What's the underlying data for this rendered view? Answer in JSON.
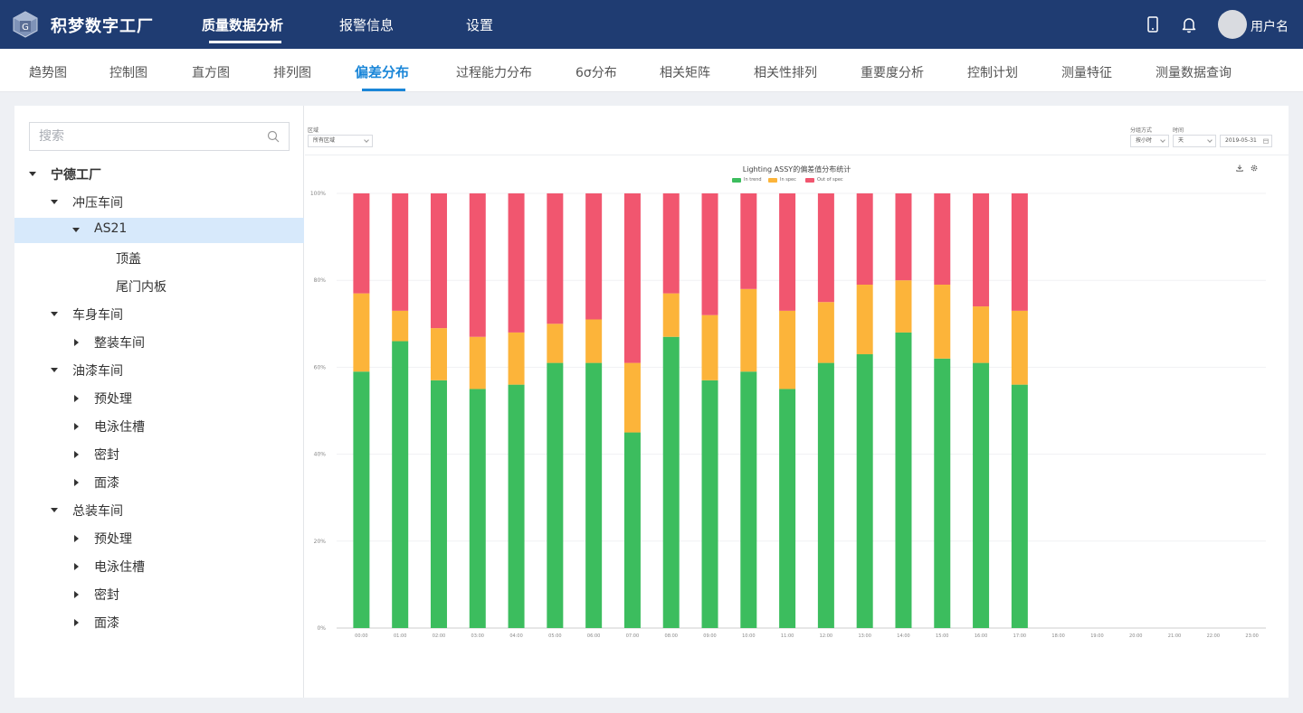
{
  "header": {
    "app_title": "积梦数字工厂",
    "nav": [
      "质量数据分析",
      "报警信息",
      "设置"
    ],
    "active_nav": "质量数据分析",
    "username": "用户名",
    "colors": {
      "background": "#1f3c72",
      "text": "#ffffff"
    },
    "icons": [
      "phone-icon",
      "bell-icon",
      "avatar"
    ]
  },
  "subnav": {
    "tabs": [
      "趋势图",
      "控制图",
      "直方图",
      "排列图",
      "偏差分布",
      "过程能力分布",
      "6σ分布",
      "相关矩阵",
      "相关性排列",
      "重要度分析",
      "控制计划",
      "测量特征",
      "测量数据查询"
    ],
    "active": "偏差分布",
    "accent_color": "#1a86d8"
  },
  "sidebar": {
    "search_placeholder": "搜索",
    "tree": [
      {
        "label": "宁德工厂",
        "level": 0,
        "state": "expanded",
        "bold": true
      },
      {
        "label": "冲压车间",
        "level": 1,
        "state": "expanded"
      },
      {
        "label": "AS21",
        "level": 2,
        "state": "expanded",
        "selected": true
      },
      {
        "label": "顶盖",
        "level": 3,
        "state": "leaf"
      },
      {
        "label": "尾门内板",
        "level": 3,
        "state": "leaf"
      },
      {
        "label": "车身车间",
        "level": 1,
        "state": "expanded"
      },
      {
        "label": "整装车间",
        "level": 2,
        "state": "collapsed"
      },
      {
        "label": "油漆车间",
        "level": 1,
        "state": "expanded"
      },
      {
        "label": "预处理",
        "level": 2,
        "state": "collapsed"
      },
      {
        "label": "电泳住槽",
        "level": 2,
        "state": "collapsed"
      },
      {
        "label": "密封",
        "level": 2,
        "state": "collapsed"
      },
      {
        "label": "面漆",
        "level": 2,
        "state": "collapsed"
      },
      {
        "label": "总装车间",
        "level": 1,
        "state": "expanded"
      },
      {
        "label": "预处理",
        "level": 2,
        "state": "collapsed"
      },
      {
        "label": "电泳住槽",
        "level": 2,
        "state": "collapsed"
      },
      {
        "label": "密封",
        "level": 2,
        "state": "collapsed"
      },
      {
        "label": "面漆",
        "level": 2,
        "state": "collapsed"
      }
    ],
    "selected_color": "#d7e9fb"
  },
  "filters": {
    "region_label": "区域",
    "region_value": "所有区域",
    "group_label": "分组方式",
    "group_value": "按小时",
    "time_label": "时间",
    "time_unit": "天",
    "date_value": "2019-05-31"
  },
  "chart_data": {
    "type": "bar",
    "stacked": true,
    "title": "Lighting ASSY的偏差值分布统计",
    "categories": [
      "00:00",
      "01:00",
      "02:00",
      "03:00",
      "04:00",
      "05:00",
      "06:00",
      "07:00",
      "08:00",
      "09:00",
      "10:00",
      "11:00",
      "12:00",
      "13:00",
      "14:00",
      "15:00",
      "16:00",
      "17:00",
      "18:00",
      "19:00",
      "20:00",
      "21:00",
      "22:00",
      "23:00"
    ],
    "series": [
      {
        "name": "In trend",
        "color": "#3cbd5e",
        "values": [
          59,
          66,
          57,
          55,
          56,
          61,
          61,
          45,
          67,
          57,
          59,
          55,
          61,
          63,
          68,
          62,
          61,
          56,
          null,
          null,
          null,
          null,
          null,
          null
        ]
      },
      {
        "name": "In spec",
        "color": "#fcb43a",
        "values": [
          18,
          7,
          12,
          12,
          12,
          9,
          10,
          16,
          10,
          15,
          19,
          18,
          14,
          16,
          12,
          17,
          13,
          17,
          null,
          null,
          null,
          null,
          null,
          null
        ]
      },
      {
        "name": "Out of spec",
        "color": "#f1566f",
        "values": [
          23,
          27,
          31,
          33,
          32,
          30,
          29,
          39,
          23,
          28,
          22,
          27,
          25,
          21,
          20,
          21,
          26,
          27,
          null,
          null,
          null,
          null,
          null,
          null
        ]
      }
    ],
    "yticks": [
      "0%",
      "20%",
      "40%",
      "60%",
      "80%",
      "100%"
    ],
    "ylim": [
      0,
      100
    ],
    "grid": true,
    "legend_position": "top-center",
    "toolbox": [
      "download-icon",
      "settings-icon"
    ]
  }
}
